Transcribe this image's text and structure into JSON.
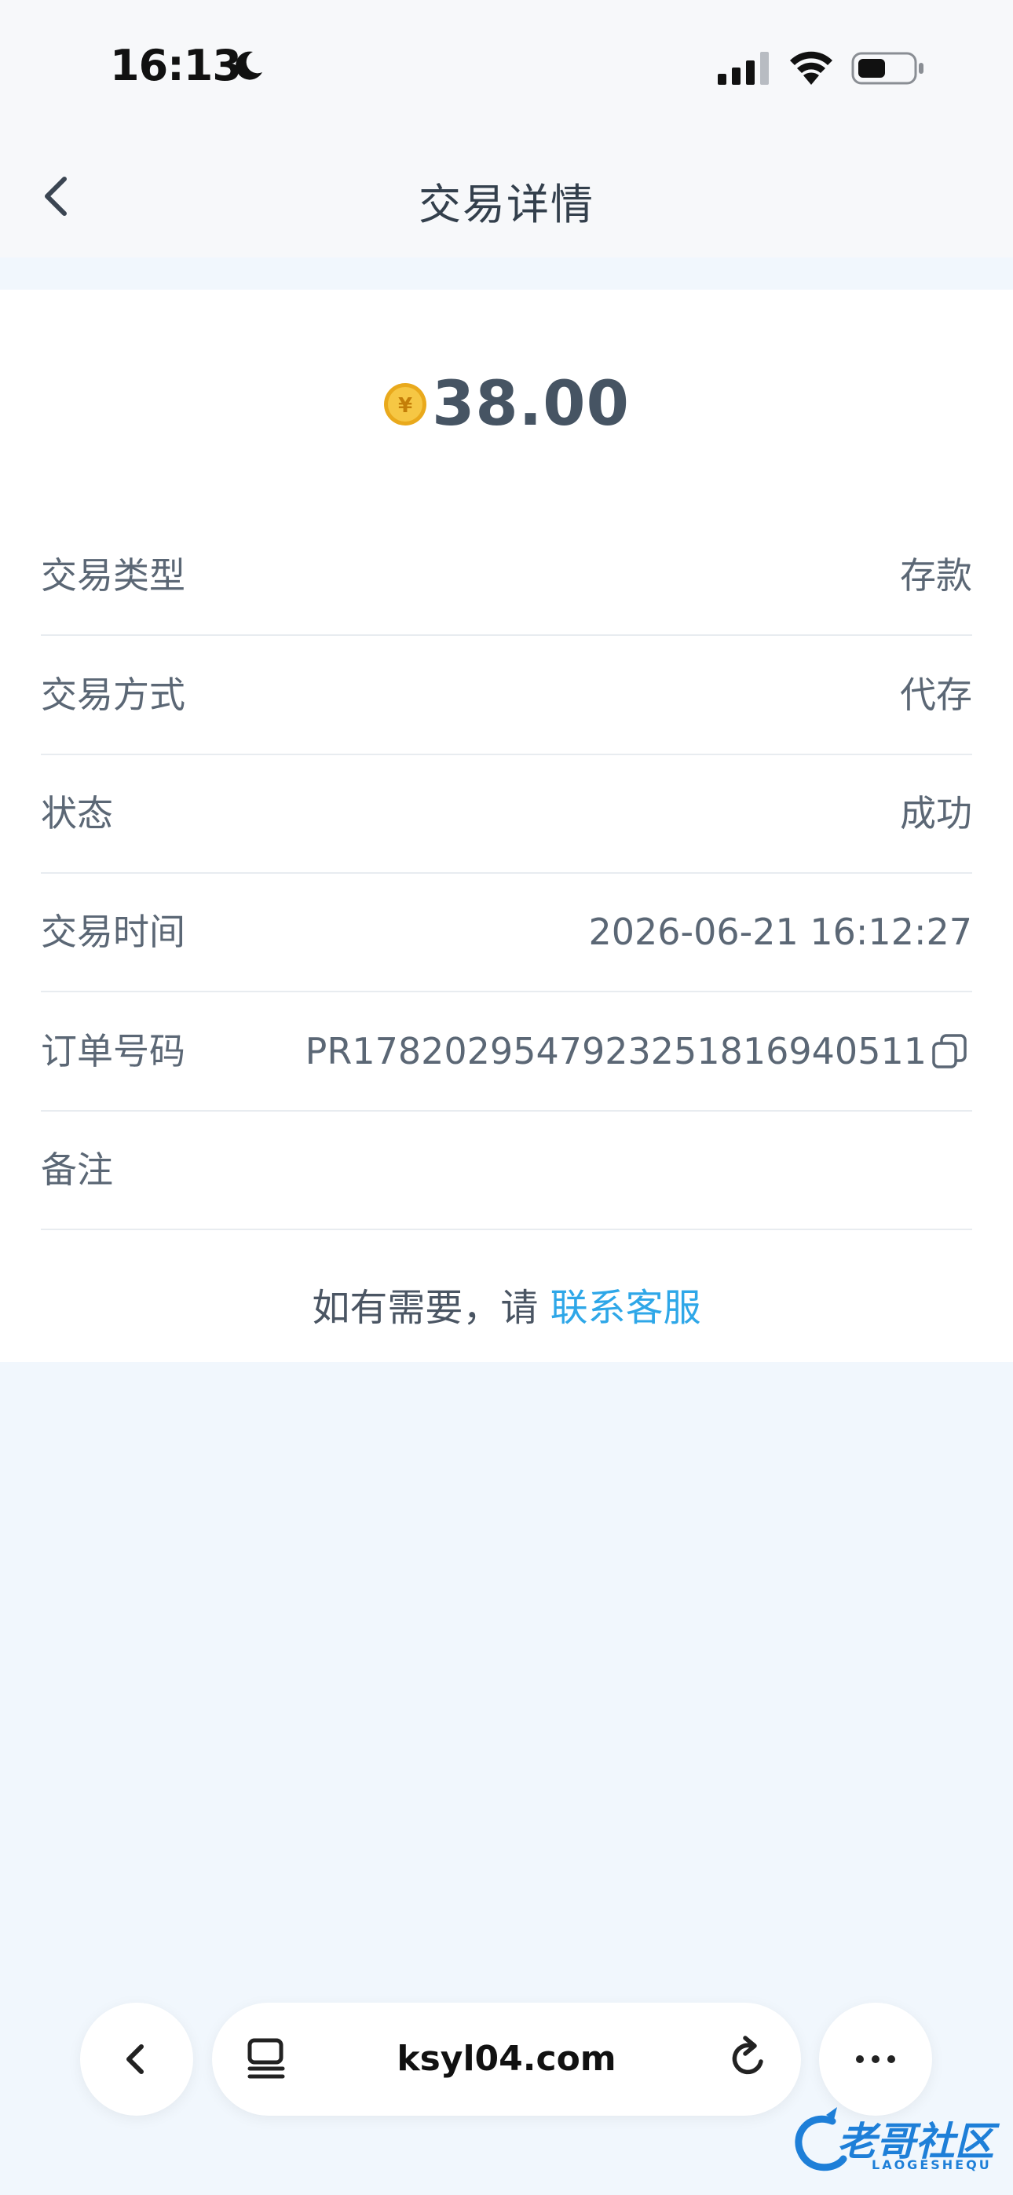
{
  "status_bar": {
    "time": "16:13",
    "moon_icon": "moon-icon",
    "signal_icon": "cellular-signal-icon",
    "wifi_icon": "wifi-icon",
    "battery_icon": "battery-icon"
  },
  "nav": {
    "title": "交易详情",
    "back_icon": "chevron-left-icon"
  },
  "transaction": {
    "amount": "38.00",
    "coin_icon": "yuan-coin-icon",
    "rows": [
      {
        "label": "交易类型",
        "value": "存款"
      },
      {
        "label": "交易方式",
        "value": "代存"
      },
      {
        "label": "状态",
        "value": "成功"
      },
      {
        "label": "交易时间",
        "value": "2026-06-21 16:12:27"
      },
      {
        "label": "订单号码",
        "value": "PR1782029547923251816940511"
      },
      {
        "label": "备注",
        "value": ""
      }
    ],
    "copy_icon": "copy-icon"
  },
  "help": {
    "prefix": "如有需要，请 ",
    "link": "联系客服"
  },
  "browser": {
    "url": "ksyl04.com",
    "back_icon": "chevron-left-icon",
    "tabs_icon": "tab-overview-icon",
    "reload_icon": "reload-icon",
    "more_icon": "more-dots-icon"
  },
  "watermark": {
    "text": "老哥社区",
    "sub": "LAOGESHEQU"
  },
  "colors": {
    "background": "#f1f7fd",
    "card": "#ffffff",
    "accent_link": "#2ea7e8",
    "text": "#5b6775"
  }
}
